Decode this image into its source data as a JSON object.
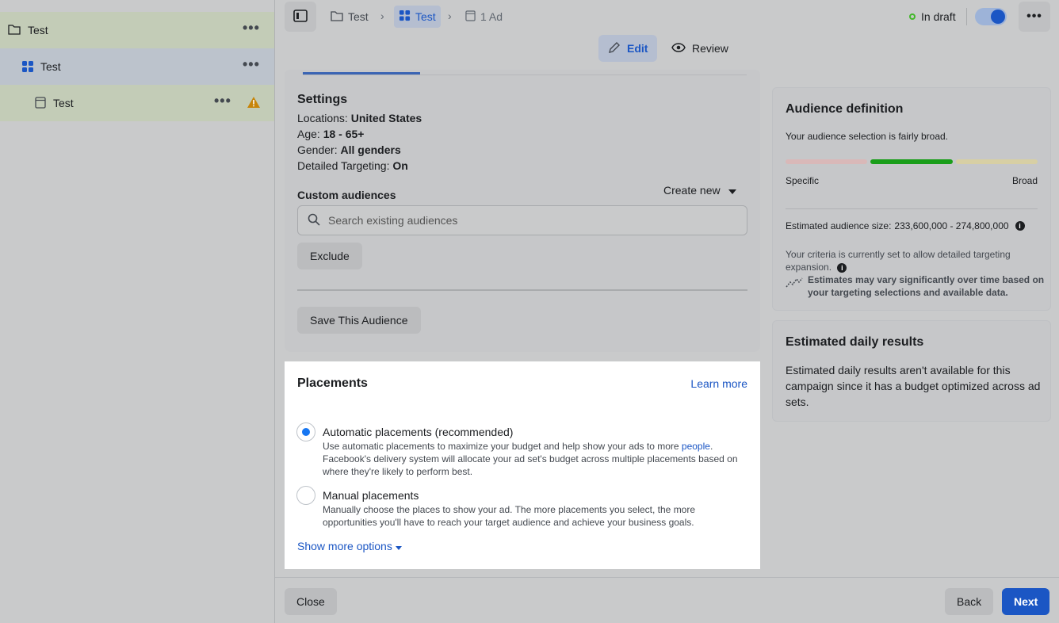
{
  "sidebar": {
    "campaign": {
      "label": "Test"
    },
    "adset": {
      "label": "Test"
    },
    "ad": {
      "label": "Test"
    },
    "more": "•••"
  },
  "topbar": {
    "crumbs": [
      {
        "label": "Test",
        "icon": "folder-icon"
      },
      {
        "label": "Test",
        "icon": "adset-grid-icon"
      },
      {
        "label": "1 Ad",
        "icon": "ad-icon"
      }
    ],
    "status": "In draft",
    "status_color": "#42b72a",
    "more": "•••"
  },
  "modes": {
    "edit": "Edit",
    "review": "Review"
  },
  "audience": {
    "settings_title": "Settings",
    "locations_label": "Locations:",
    "locations_value": "United States",
    "age_label": "Age:",
    "age_value": "18 - 65+",
    "gender_label": "Gender:",
    "gender_value": "All genders",
    "targeting_label": "Detailed Targeting:",
    "targeting_value": "On",
    "custom_label": "Custom audiences",
    "create_new": "Create new",
    "search_placeholder": "Search existing audiences",
    "exclude": "Exclude",
    "save": "Save This Audience"
  },
  "placements": {
    "title": "Placements",
    "learn_more": "Learn more",
    "auto_title": "Automatic placements (recommended)",
    "auto_desc_1": "Use automatic placements to maximize your budget and help show your ads to more ",
    "auto_desc_link": "people",
    "auto_desc_2": ". Facebook's delivery system will allocate your ad set's budget across multiple placements based on where they're likely to perform best.",
    "manual_title": "Manual placements",
    "manual_desc": "Manually choose the places to show your ad. The more placements you select, the more opportunities you'll have to reach your target audience and achieve your business goals.",
    "show_more": "Show more options",
    "selected": "automatic"
  },
  "audience_definition": {
    "title": "Audience definition",
    "summary": "Your audience selection is fairly broad.",
    "specific": "Specific",
    "broad": "Broad",
    "size_label": "Estimated audience size:",
    "size_value": "233,600,000 - 274,800,000",
    "criteria": "Your criteria is currently set to allow detailed targeting expansion.",
    "estimates_note": "Estimates may vary significantly over time based on your targeting selections and available data.",
    "meter_colors": [
      "#d9b8b8",
      "#1a9e1a",
      "#d7cfa4"
    ]
  },
  "daily_results": {
    "title": "Estimated daily results",
    "text": "Estimated daily results aren't available for this campaign since it has a budget optimized across ad sets."
  },
  "footer": {
    "close": "Close",
    "back": "Back",
    "next": "Next"
  }
}
